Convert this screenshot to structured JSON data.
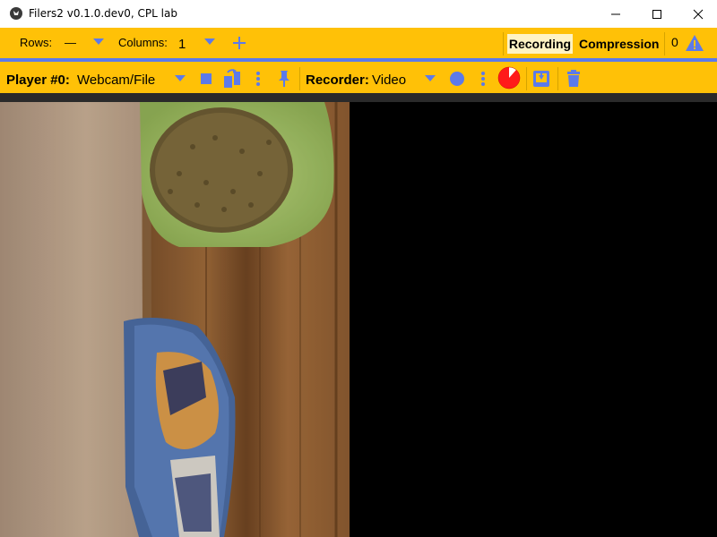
{
  "window": {
    "title": "Filers2 v0.1.0.dev0, CPL lab",
    "controls": [
      "minimize",
      "maximize",
      "close"
    ]
  },
  "grid_bar": {
    "rows_label": "Rows:",
    "rows_value": "—",
    "columns_label": "Columns:",
    "columns_value": "1",
    "tabs": [
      "Recording",
      "Compression"
    ],
    "active_tab": "Recording",
    "warning_count": "0"
  },
  "player_bar": {
    "player_label": "Player #0:",
    "player_source": "Webcam/File",
    "recorder_label": "Recorder:",
    "recorder_type": "Video",
    "icons": [
      "stop-icon",
      "refresh-icon",
      "more-vert-icon",
      "pin-icon",
      "record-icon",
      "more-vert-icon",
      "disk-usage-pie-icon",
      "download-icon",
      "delete-icon"
    ]
  },
  "colors": {
    "toolbar": "#FFC107",
    "accent_blue": "#5C7AEA",
    "record_red": "#FF1A1A",
    "background": "#000000"
  }
}
